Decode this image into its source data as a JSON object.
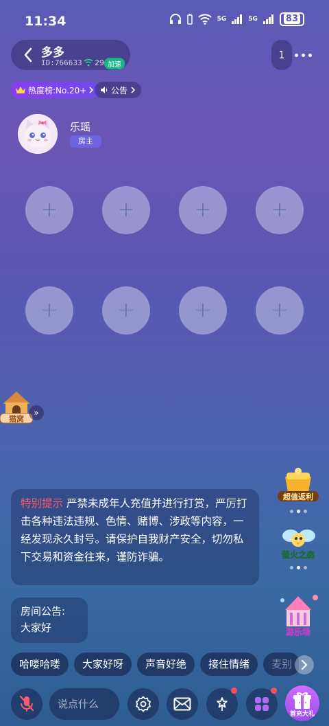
{
  "status_bar": {
    "time": "11:34",
    "network_1": "5G",
    "network_2": "5G",
    "battery": "83"
  },
  "room": {
    "name": "多多",
    "id_label": "ID:766633",
    "signal_strength": "29",
    "speed_badge": "加速",
    "online_count": "1"
  },
  "tags": {
    "hot_rank": "热度榜:No.20+",
    "notice": "公告"
  },
  "host": {
    "name": "乐瑶",
    "role_badge": "房主"
  },
  "seats": {
    "add_symbol": "+"
  },
  "cathouse": {
    "label": "猫窝"
  },
  "promos": [
    {
      "label": "超值返利"
    },
    {
      "label": "萤火之森"
    },
    {
      "label": "游乐场"
    }
  ],
  "tips": {
    "title": "特别提示",
    "body": " 严禁未成年人充值并进行打赏，严厉打击各种违法违规、色情、赌博、涉政等内容，一经发现永久封号。请保护自我财产安全，切勿私下交易和资金往来，谨防诈骗。"
  },
  "announcement": {
    "label": "房间公告:",
    "text": "大家好"
  },
  "quick_replies": [
    "哈喽哈喽",
    "大家好呀",
    "声音好绝",
    "接住情绪",
    "麦别"
  ],
  "bottom_bar": {
    "input_placeholder": "说点什么",
    "gift_label": "首充大礼"
  },
  "colors": {
    "tip_title": "#ff5a6e",
    "badge_green": "#19b38b",
    "host_badge": "#6d62e0",
    "red_dot": "#ff4f5e"
  }
}
